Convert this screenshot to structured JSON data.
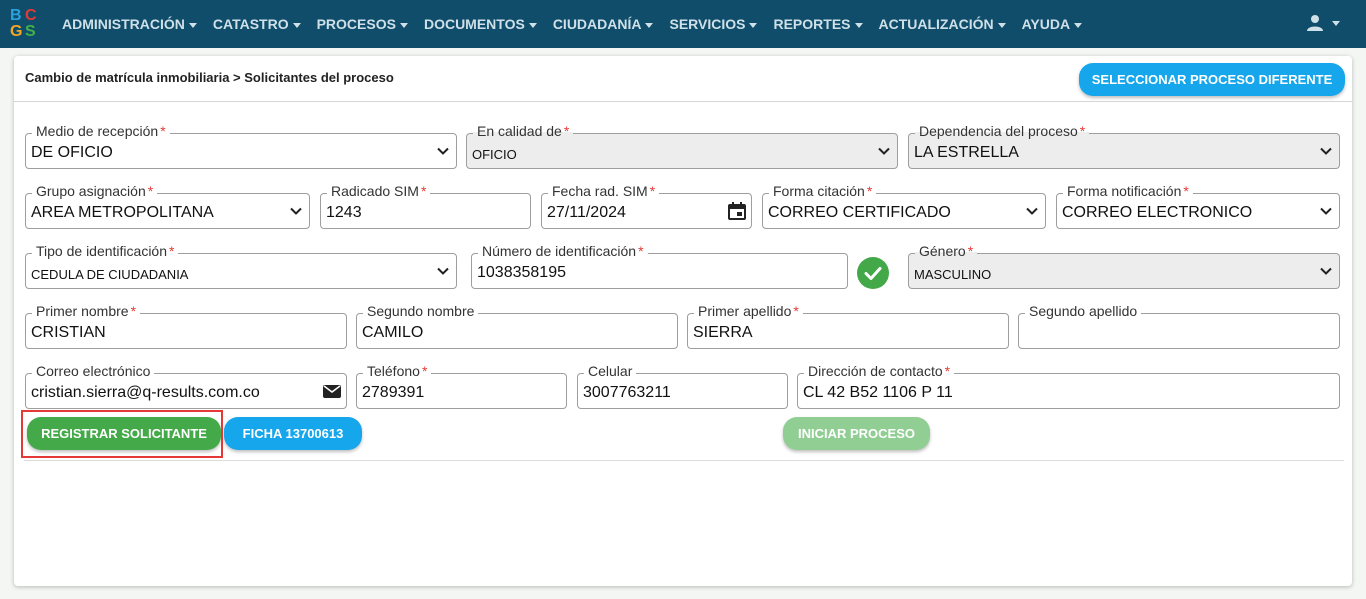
{
  "app": {
    "logo": {
      "letters": [
        "B",
        "C",
        "G",
        "S"
      ]
    }
  },
  "nav": {
    "items": [
      {
        "label": "ADMINISTRACIÓN"
      },
      {
        "label": "CATASTRO"
      },
      {
        "label": "PROCESOS"
      },
      {
        "label": "DOCUMENTOS"
      },
      {
        "label": "CIUDADANÍA"
      },
      {
        "label": "SERVICIOS"
      },
      {
        "label": "REPORTES"
      },
      {
        "label": "ACTUALIZACIÓN"
      },
      {
        "label": "AYUDA"
      }
    ],
    "user_icon": "user-icon"
  },
  "header": {
    "breadcrumb": "Cambio de matrícula inmobiliaria > Solicitantes del proceso",
    "select_process_button": "SELECCIONAR PROCESO DIFERENTE"
  },
  "form": {
    "medio_recepcion": {
      "label": "Medio de recepción",
      "value": "DE OFICIO"
    },
    "en_calidad_de": {
      "label": "En calidad de",
      "value": "OFICIO"
    },
    "dependencia": {
      "label": "Dependencia del proceso",
      "value": "LA ESTRELLA"
    },
    "grupo_asignacion": {
      "label": "Grupo asignación",
      "value": "AREA METROPOLITANA"
    },
    "radicado_sim": {
      "label": "Radicado SIM",
      "value": "1243"
    },
    "fecha_rad_sim": {
      "label": "Fecha rad. SIM",
      "value": "27/11/2024"
    },
    "forma_citacion": {
      "label": "Forma citación",
      "value": "CORREO CERTIFICADO"
    },
    "forma_notificacion": {
      "label": "Forma notificación",
      "value": "CORREO ELECTRONICO"
    },
    "tipo_identificacion": {
      "label": "Tipo de identificación",
      "value": "CEDULA DE CIUDADANIA"
    },
    "numero_identificacion": {
      "label": "Número de identificación",
      "value": "1038358195"
    },
    "genero": {
      "label": "Género",
      "value": "MASCULINO"
    },
    "primer_nombre": {
      "label": "Primer nombre",
      "value": "CRISTIAN"
    },
    "segundo_nombre": {
      "label": "Segundo nombre",
      "value": "CAMILO"
    },
    "primer_apellido": {
      "label": "Primer apellido",
      "value": "SIERRA"
    },
    "segundo_apellido": {
      "label": "Segundo apellido",
      "value": ""
    },
    "correo": {
      "label": "Correo electrónico",
      "value": "cristian.sierra@q-results.com.co"
    },
    "telefono": {
      "label": "Teléfono",
      "value": "2789391"
    },
    "celular": {
      "label": "Celular",
      "value": "3007763211"
    },
    "direccion": {
      "label": "Dirección de contacto",
      "value": "CL 42 B52 1106 P 11"
    },
    "required_mark": "*"
  },
  "actions": {
    "registrar": "REGISTRAR SOLICITANTE",
    "ficha": "FICHA 13700613",
    "iniciar": "INICIAR PROCESO"
  },
  "colors": {
    "navbar": "#0f4d6b",
    "primary_blue": "#16a6ec",
    "success_green": "#44a948",
    "required_red": "#e53935"
  }
}
